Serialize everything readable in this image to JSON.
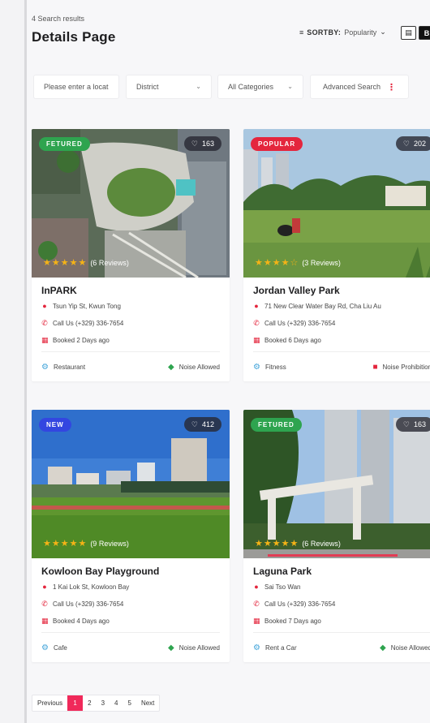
{
  "header": {
    "results_count": "4 Search results",
    "title": "Details Page",
    "sort_label": "SORTBY:",
    "sort_value": "Popularity",
    "view_grid_label": "B"
  },
  "filters": {
    "location_placeholder": "Please enter a locat",
    "district": "District",
    "categories": "All Categories",
    "advanced": "Advanced Search"
  },
  "listings": [
    {
      "badge": "FETURED",
      "badge_color": "#2ea44f",
      "likes": "163",
      "reviews": "(6 Reviews)",
      "name": "InPARK",
      "address": "Tsun Yip St, Kwun Tong",
      "phone": "Call Us (+329) 336-7654",
      "booked": "Booked 2 Days ago",
      "category": "Restaurant",
      "noise": "Noise Allowed",
      "noise_allowed": true
    },
    {
      "badge": "POPULAR",
      "badge_color": "#e4263d",
      "likes": "202",
      "reviews": "(3 Reviews)",
      "name": "Jordan Valley Park",
      "address": "71 New Clear Water Bay Rd, Cha Liu Au",
      "phone": "Call Us (+329) 336-7654",
      "booked": "Booked 6 Days ago",
      "category": "Fitness",
      "noise": "Noise Prohibition",
      "noise_allowed": false
    },
    {
      "badge": "NEW",
      "badge_color": "#3346e0",
      "likes": "412",
      "reviews": "(9 Reviews)",
      "name": "Kowloon Bay Playground",
      "address": "1 Kai Lok St, Kowloon Bay",
      "phone": "Call Us (+329) 336-7654",
      "booked": "Booked 4 Days ago",
      "category": "Cafe",
      "noise": "Noise Allowed",
      "noise_allowed": true
    },
    {
      "badge": "FETURED",
      "badge_color": "#2ea44f",
      "likes": "163",
      "reviews": "(6 Reviews)",
      "name": "Laguna Park",
      "address": "Sai Tso Wan",
      "phone": "Call Us (+329) 336-7654",
      "booked": "Booked 7 Days ago",
      "category": "Rent a Car",
      "noise": "Noise Allowed",
      "noise_allowed": true
    }
  ],
  "pagination": {
    "previous": "Previous",
    "pages": [
      "1",
      "2",
      "3",
      "4",
      "5"
    ],
    "active_page": "1",
    "next": "Next"
  },
  "colors": {
    "accent": "#e4263d",
    "page_active": "#f0295a",
    "allowed": "#2ea44f"
  },
  "icons": {
    "sort": "sort-lines-icon",
    "location": "map-pin-icon",
    "phone": "phone-icon",
    "calendar": "calendar-icon",
    "heart": "heart-icon",
    "lock_open": "lock-open-icon",
    "lock_closed": "lock-closed-icon"
  }
}
